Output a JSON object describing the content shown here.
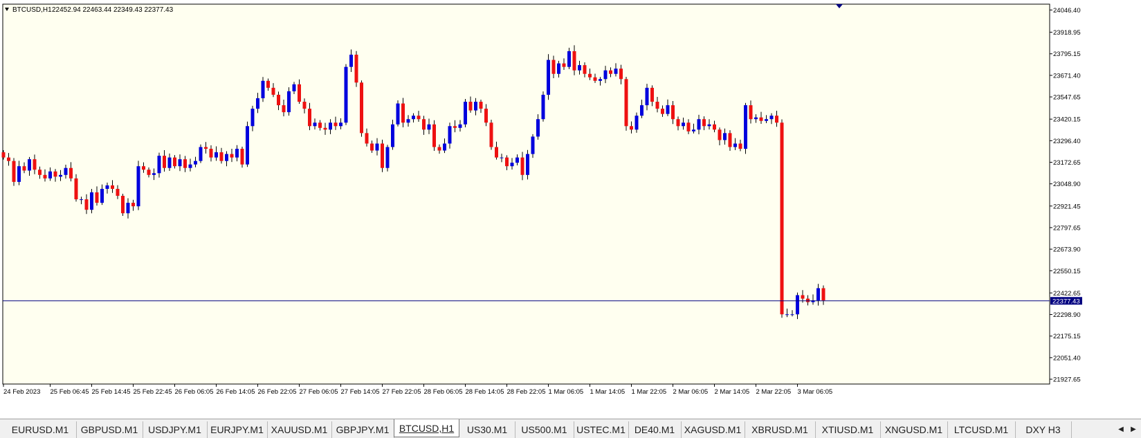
{
  "chart_data": {
    "type": "candlestick",
    "symbol_label": "BTCUSD,H1",
    "ohlc_label": "22452.94 22463.44 22349.43 22377.43",
    "current_price": 22377.43,
    "current_price_label": "22377.43",
    "ylim": [
      21900,
      24080
    ],
    "y_ticks": [
      24046.4,
      23918.95,
      23795.15,
      23671.4,
      23547.65,
      23420.15,
      23296.4,
      23172.65,
      23048.9,
      22921.45,
      22797.65,
      22673.9,
      22550.15,
      22422.65,
      22298.9,
      22175.15,
      22051.4,
      21927.65
    ],
    "y_tick_labels": [
      "24046.40",
      "23918.95",
      "23795.15",
      "23671.40",
      "23547.65",
      "23420.15",
      "23296.40",
      "23172.65",
      "23048.90",
      "22921.45",
      "22797.65",
      "22673.90",
      "22550.15",
      "22422.65",
      "22298.90",
      "22175.15",
      "22051.40",
      "21927.65"
    ],
    "x_tick_labels": [
      "24 Feb 2023",
      "25 Feb 06:45",
      "25 Feb 14:45",
      "25 Feb 22:45",
      "26 Feb 06:05",
      "26 Feb 14:05",
      "26 Feb 22:05",
      "27 Feb 06:05",
      "27 Feb 14:05",
      "27 Feb 22:05",
      "28 Feb 06:05",
      "28 Feb 14:05",
      "28 Feb 22:05",
      "1 Mar 06:05",
      "1 Mar 14:05",
      "1 Mar 22:05",
      "2 Mar 06:05",
      "2 Mar 14:05",
      "2 Mar 22:05",
      "3 Mar 06:05"
    ],
    "x_tick_bar_index": [
      0,
      9,
      17,
      25,
      33,
      41,
      49,
      57,
      65,
      73,
      81,
      89,
      97,
      105,
      113,
      121,
      129,
      137,
      145,
      153
    ],
    "closes": [
      23200,
      23180,
      23060,
      23150,
      23125,
      23190,
      23130,
      23100,
      23080,
      23120,
      23090,
      23100,
      23140,
      23080,
      22960,
      22960,
      22900,
      23000,
      22940,
      23020,
      23040,
      23020,
      22980,
      22880,
      22940,
      22920,
      23150,
      23130,
      23100,
      23110,
      23210,
      23140,
      23200,
      23150,
      23190,
      23140,
      23160,
      23180,
      23260,
      23250,
      23200,
      23230,
      23180,
      23220,
      23200,
      23250,
      23160,
      23380,
      23480,
      23540,
      23640,
      23600,
      23560,
      23500,
      23460,
      23580,
      23620,
      23520,
      23480,
      23380,
      23400,
      23370,
      23360,
      23400,
      23380,
      23400,
      23720,
      23790,
      23630,
      23340,
      23280,
      23240,
      23280,
      23140,
      23260,
      23390,
      23510,
      23400,
      23420,
      23440,
      23420,
      23360,
      23390,
      23260,
      23240,
      23280,
      23380,
      23370,
      23390,
      23520,
      23470,
      23520,
      23480,
      23400,
      23260,
      23200,
      23200,
      23150,
      23170,
      23200,
      23100,
      23220,
      23320,
      23420,
      23560,
      23760,
      23680,
      23740,
      23720,
      23810,
      23700,
      23730,
      23680,
      23660,
      23640,
      23650,
      23700,
      23680,
      23710,
      23650,
      23380,
      23360,
      23440,
      23500,
      23600,
      23520,
      23480,
      23450,
      23500,
      23420,
      23380,
      23400,
      23350,
      23360,
      23420,
      23380,
      23390,
      23360,
      23300,
      23340,
      23260,
      23280,
      23250,
      23500,
      23420,
      23430,
      23410,
      23420,
      23440,
      23400,
      22300,
      22300,
      22300,
      22410,
      22390,
      22370,
      22380,
      22450,
      22380
    ]
  },
  "tabs": [
    {
      "label": "EURUSD.M1"
    },
    {
      "label": "GBPUSD.M1"
    },
    {
      "label": "USDJPY.M1"
    },
    {
      "label": "EURJPY.M1"
    },
    {
      "label": "XAUUSD.M1"
    },
    {
      "label": "GBPJPY.M1"
    },
    {
      "label": "BTCUSD,H1",
      "active": true
    },
    {
      "label": "US30.M1"
    },
    {
      "label": "US500.M1"
    },
    {
      "label": "USTEC.M1"
    },
    {
      "label": "DE40.M1"
    },
    {
      "label": "XAGUSD.M1"
    },
    {
      "label": "XBRUSD.M1"
    },
    {
      "label": "XTIUSD.M1"
    },
    {
      "label": "XNGUSD.M1"
    },
    {
      "label": "LTCUSD.M1"
    },
    {
      "label": "DXY H3"
    }
  ],
  "colors": {
    "background": "#fffff0",
    "bull": "#0000dd",
    "bear": "#ee1111",
    "wick": "#000000",
    "price_line": "#000080",
    "text": "#000000"
  }
}
